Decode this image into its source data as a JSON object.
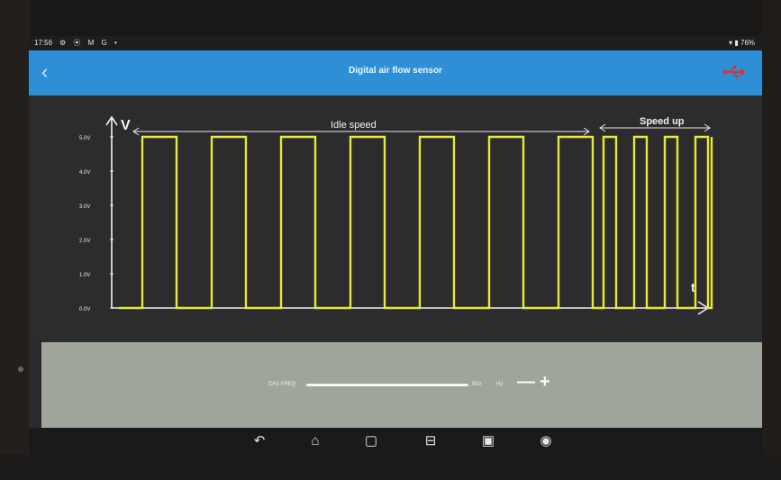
{
  "status_bar": {
    "time": "17:56",
    "left_icons": [
      "gear-icon",
      "tbox-icon",
      "gmail-icon",
      "google-icon",
      "dot-icon"
    ],
    "left_icons_text": "⚙ ⦿ M G •",
    "right_text": "▾ ▮ 76%",
    "battery": "76%"
  },
  "app_bar": {
    "title": "Digital air flow sensor",
    "back_icon": "back-chevron-icon",
    "connection_icon": "usb-icon",
    "back_glyph": "‹"
  },
  "waveform": {
    "y_axis_label": "V",
    "x_axis_label": "t",
    "y_ticks": [
      "5.0V",
      "4.0V",
      "3.0V",
      "2.0V",
      "1.0V",
      "0.0V"
    ],
    "annotations": {
      "idle": "Idle speed",
      "speed_up": "Speed up"
    },
    "high_level_v": 5.0,
    "low_level_v": 0.0,
    "trace_color": "#e8e83a",
    "idle_cycles": 7,
    "speed_up_cycles": 4
  },
  "controls": {
    "channel_label": "CH1 FREQ",
    "slider_value": "500",
    "unit": "Hz",
    "minus_label": "—",
    "plus_label": "+"
  },
  "nav_bar": {
    "buttons": [
      {
        "name": "back-nav-icon",
        "glyph": "↶"
      },
      {
        "name": "home-icon",
        "glyph": "⌂"
      },
      {
        "name": "recents-icon",
        "glyph": "▢"
      },
      {
        "name": "vci-icon",
        "glyph": "⊟"
      },
      {
        "name": "screenshot-icon",
        "glyph": "▣"
      },
      {
        "name": "browser-icon",
        "glyph": "◉"
      }
    ]
  }
}
